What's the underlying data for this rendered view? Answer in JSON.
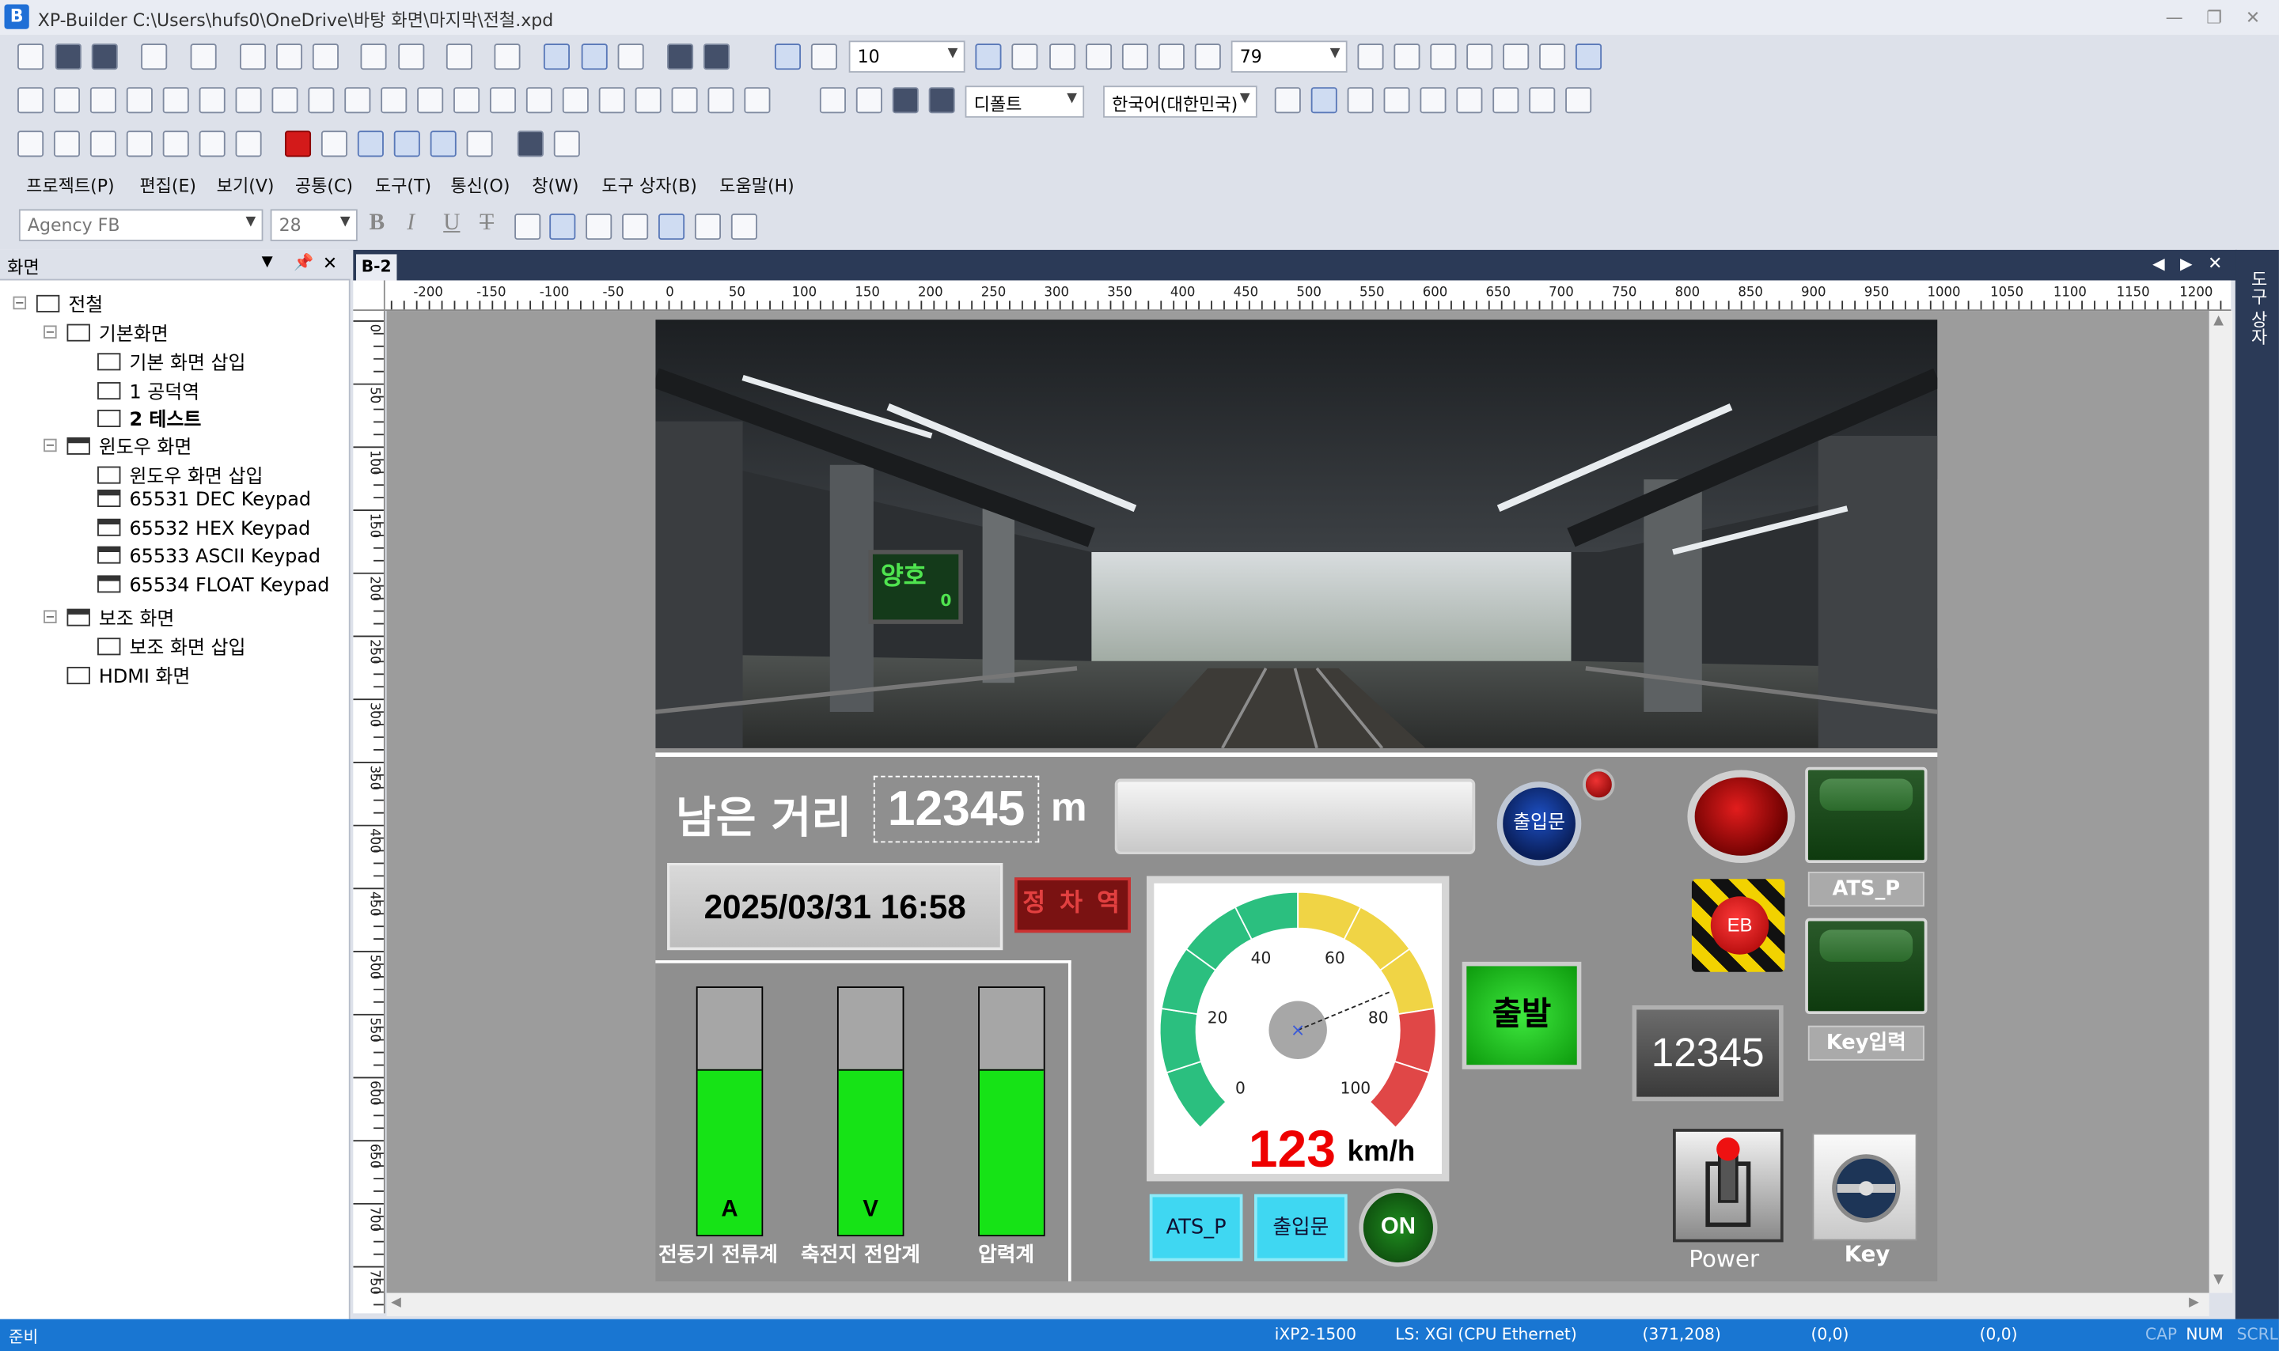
{
  "app": {
    "title": "XP-Builder C:\\Users\\hufs0\\OneDrive\\바탕 화면\\마지막\\전철.xpd",
    "logo_letter": "B"
  },
  "toolbar": {
    "grid_size": "10",
    "zoom": "79",
    "font_style": "디폴트",
    "language": "한국어(대한민국)",
    "font_name": "Agency FB",
    "font_size": "28"
  },
  "menu": [
    "프로젝트(P)",
    "편집(E)",
    "보기(V)",
    "공통(C)",
    "도구(T)",
    "통신(O)",
    "창(W)",
    "도구 상자(B)",
    "도움말(H)"
  ],
  "panel": {
    "title": "화면",
    "tree": [
      {
        "label": "전철",
        "level": 0
      },
      {
        "label": "기본화면",
        "level": 1
      },
      {
        "label": "기본 화면 삽입",
        "level": 2
      },
      {
        "label": "1 공덕역",
        "level": 2
      },
      {
        "label": "2 테스트",
        "level": 2
      },
      {
        "label": "윈도우 화면",
        "level": 1
      },
      {
        "label": "윈도우 화면 삽입",
        "level": 2
      },
      {
        "label": "65531 DEC Keypad",
        "level": 2
      },
      {
        "label": "65532 HEX Keypad",
        "level": 2
      },
      {
        "label": "65533 ASCII Keypad",
        "level": 2
      },
      {
        "label": "65534 FLOAT Keypad",
        "level": 2
      },
      {
        "label": "보조 화면",
        "level": 1
      },
      {
        "label": "보조 화면 삽입",
        "level": 2
      },
      {
        "label": "HDMI 화면",
        "level": 1
      }
    ]
  },
  "editor": {
    "tab": "B-2",
    "right_strip": "도구 상자"
  },
  "ruler": {
    "h_labels": [
      "-200",
      "-150",
      "-100",
      "-50",
      "0",
      "50",
      "100",
      "150",
      "200",
      "250",
      "300",
      "350",
      "400",
      "450",
      "500",
      "550",
      "600",
      "650",
      "700",
      "750",
      "800",
      "850",
      "900",
      "950",
      "1000",
      "1050",
      "1100",
      "1150",
      "1200"
    ],
    "v_labels": [
      "0",
      "50",
      "100",
      "150",
      "200",
      "250",
      "300",
      "350",
      "400",
      "450",
      "500",
      "550",
      "600",
      "650",
      "700",
      "750"
    ]
  },
  "hmi": {
    "station_sign": "양호",
    "station_sign_num": "0",
    "remaining_label": "남은 거리",
    "remaining_value": "12345",
    "remaining_unit": "m",
    "datetime": "2025/03/31   16:58",
    "stop_station": "정 차 역",
    "door_button": "출입문",
    "depart_button": "출발",
    "speed_value": "123",
    "speed_unit": "km/h",
    "gauge_ticks": [
      "0",
      "20",
      "40",
      "60",
      "80",
      "100"
    ],
    "gauge_needle_value": 75,
    "gauge_max": 100,
    "eb_label": "EB",
    "ats_p_label": "ATS_P",
    "key_input_label": "Key입력",
    "numeric_display": "12345",
    "power_label": "Power",
    "key_label": "Key",
    "ats_p_button": "ATS_P",
    "door_small_button": "출입문",
    "on_button": "ON",
    "tanks": [
      {
        "letter": "A",
        "label": "전동기 전류계",
        "level": 0.67
      },
      {
        "letter": "V",
        "label": "축전지 전압계",
        "level": 0.67
      },
      {
        "letter": "",
        "label": "압력계",
        "level": 0.67
      }
    ],
    "colors": {
      "lamp_green": "#16e316",
      "alarm_red": "#e00000",
      "gauge_green": "#2bbf7f",
      "gauge_yellow": "#f0d445",
      "gauge_red": "#e04747"
    }
  },
  "status": {
    "ready": "준비",
    "device": "iXP2-1500",
    "plc": "LS: XGI (CPU Ethernet)",
    "cursor": "(371,208)",
    "pos1": "(0,0)",
    "pos2": "(0,0)",
    "cap": "CAP",
    "num": "NUM",
    "scrl": "SCRL"
  }
}
